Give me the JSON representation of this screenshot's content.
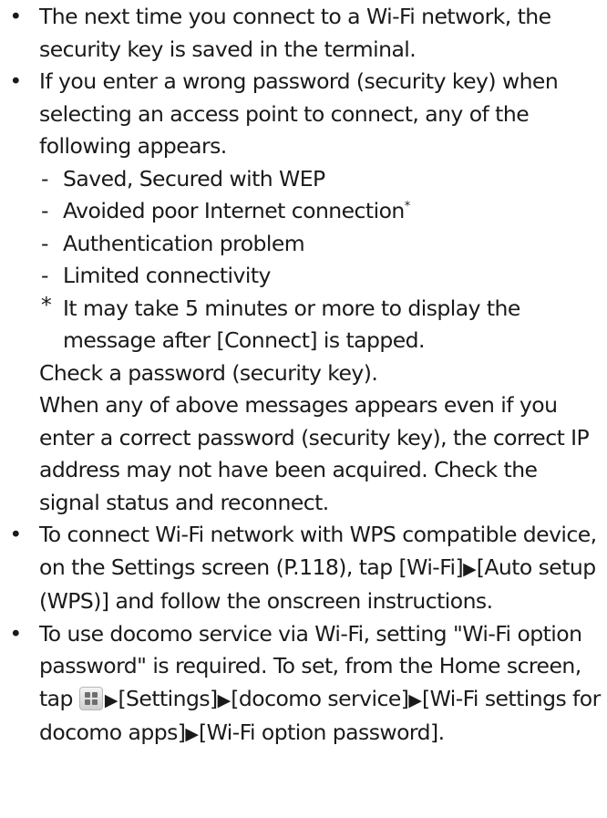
{
  "bullet_symbol": "•",
  "dash_symbol": "-",
  "note_symbol": "*",
  "arrow_symbol": "▶",
  "bullets": {
    "b1": {
      "text": "The next time you connect to a Wi-Fi network, the security key is saved in the terminal."
    },
    "b2": {
      "intro": "If you enter a wrong password (security key) when selecting an access point to connect, any of the following appears.",
      "items": [
        "Saved, Secured with WEP",
        "Avoided poor Internet connection",
        "Authentication problem",
        "Limited connectivity"
      ],
      "item_footnote_mark": "*",
      "note": "It may take 5 minutes or more to display the message after [Connect] is tapped.",
      "check": "Check a password (security key).",
      "when": "When any of above messages appears even if you enter a correct password (security key), the correct IP address may not have been acquired. Check the signal status and reconnect."
    },
    "b3": {
      "part1": "To connect Wi-Fi network with WPS compatible device, on the Settings screen (P.118), tap [Wi-Fi]",
      "part2": "[Auto setup (WPS)] and follow the onscreen instructions."
    },
    "b4": {
      "part1": "To use docomo service via Wi-Fi, setting \"Wi-Fi option password\" is required. To set, from the Home screen, tap",
      "part2": "[Settings]",
      "part3": "[docomo service]",
      "part4": "[Wi-Fi settings for docomo apps]",
      "part5": "[Wi-Fi option password]."
    }
  }
}
